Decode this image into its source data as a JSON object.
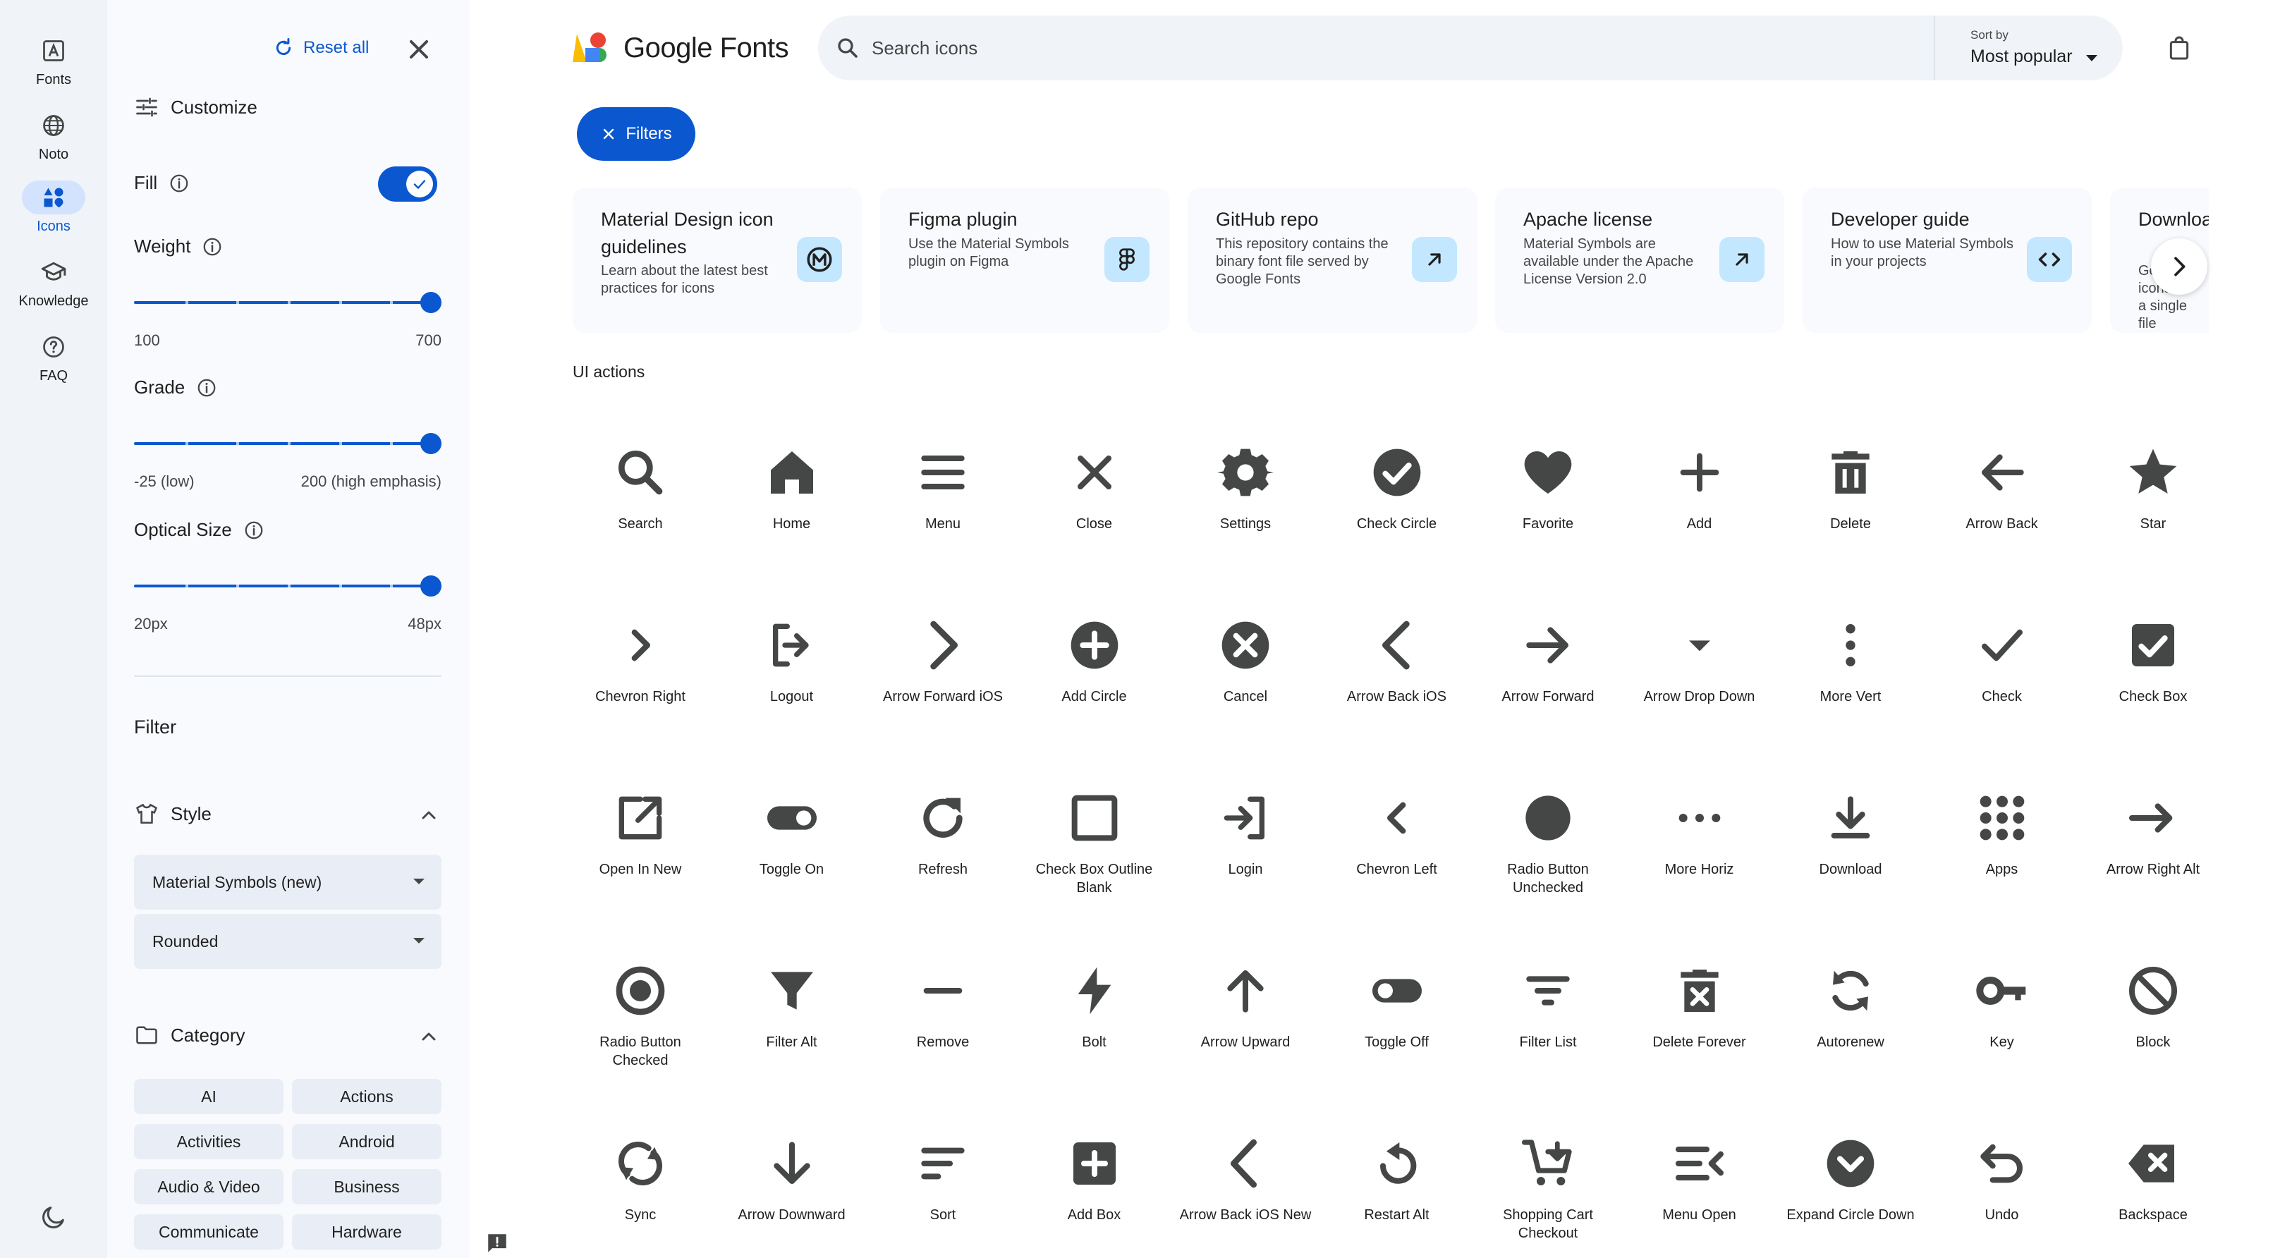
{
  "rail": {
    "items": [
      {
        "label": "Fonts",
        "icon": "fonts-icon"
      },
      {
        "label": "Noto",
        "icon": "globe-icon"
      },
      {
        "label": "Icons",
        "icon": "icons-category-icon",
        "active": true
      },
      {
        "label": "Knowledge",
        "icon": "school-icon"
      },
      {
        "label": "FAQ",
        "icon": "help-icon"
      }
    ],
    "theme_icon": "dark-mode-icon"
  },
  "panel": {
    "reset_label": "Reset all",
    "customize_label": "Customize",
    "fill_label": "Fill",
    "fill_on": true,
    "weight_label": "Weight",
    "weight_min": "100",
    "weight_max": "700",
    "weight_value": 1.0,
    "grade_label": "Grade",
    "grade_min": "-25 (low)",
    "grade_max": "200 (high emphasis)",
    "grade_value": 1.0,
    "optical_label": "Optical Size",
    "optical_min": "20px",
    "optical_max": "48px",
    "optical_value": 1.0,
    "filter_label": "Filter",
    "style_label": "Style",
    "style_select": "Material Symbols (new)",
    "variant_select": "Rounded",
    "category_label": "Category",
    "chips": [
      "AI",
      "Actions",
      "Activities",
      "Android",
      "Audio & Video",
      "Business",
      "Communicate",
      "Hardware"
    ]
  },
  "header": {
    "logo_text": "Google Fonts",
    "search_placeholder": "Search icons",
    "sort_caption": "Sort by",
    "sort_value": "Most popular",
    "filters_label": "Filters"
  },
  "cards": [
    {
      "title": "Material Design icon guidelines",
      "desc": "Learn about the latest best practices for icons",
      "icon": "material-logo-icon"
    },
    {
      "title": "Figma plugin",
      "desc": "Use the Material Symbols plugin on Figma",
      "icon": "figma-icon"
    },
    {
      "title": "GitHub repo",
      "desc": "This repository contains the binary font file served by Google Fonts",
      "icon": "arrow-outward-icon"
    },
    {
      "title": "Apache license",
      "desc": "Material Symbols are available under the Apache License Version 2.0",
      "icon": "arrow-outward-icon"
    },
    {
      "title": "Developer guide",
      "desc": "How to use Material Symbols in your projects",
      "icon": "code-icon"
    },
    {
      "title": "Download all Symbols",
      "desc": "Get all icons in a single file",
      "icon": "download-icon"
    }
  ],
  "section_title": "UI actions",
  "icons": [
    {
      "label": "Search",
      "icon": "search"
    },
    {
      "label": "Home",
      "icon": "home"
    },
    {
      "label": "Menu",
      "icon": "menu"
    },
    {
      "label": "Close",
      "icon": "close"
    },
    {
      "label": "Settings",
      "icon": "settings"
    },
    {
      "label": "Check Circle",
      "icon": "check_circle"
    },
    {
      "label": "Favorite",
      "icon": "favorite"
    },
    {
      "label": "Add",
      "icon": "add"
    },
    {
      "label": "Delete",
      "icon": "delete"
    },
    {
      "label": "Arrow Back",
      "icon": "arrow_back"
    },
    {
      "label": "Star",
      "icon": "star"
    },
    {
      "label": "Chevron Right",
      "icon": "chevron_right"
    },
    {
      "label": "Logout",
      "icon": "logout"
    },
    {
      "label": "Arrow Forward iOS",
      "icon": "arrow_forward_ios"
    },
    {
      "label": "Add Circle",
      "icon": "add_circle"
    },
    {
      "label": "Cancel",
      "icon": "cancel"
    },
    {
      "label": "Arrow Back iOS",
      "icon": "arrow_back_ios"
    },
    {
      "label": "Arrow Forward",
      "icon": "arrow_forward"
    },
    {
      "label": "Arrow Drop Down",
      "icon": "arrow_drop_down"
    },
    {
      "label": "More Vert",
      "icon": "more_vert"
    },
    {
      "label": "Check",
      "icon": "check"
    },
    {
      "label": "Check Box",
      "icon": "check_box"
    },
    {
      "label": "Open In New",
      "icon": "open_in_new"
    },
    {
      "label": "Toggle On",
      "icon": "toggle_on"
    },
    {
      "label": "Refresh",
      "icon": "refresh"
    },
    {
      "label": "Check Box Outline Blank",
      "icon": "check_box_outline_blank"
    },
    {
      "label": "Login",
      "icon": "login"
    },
    {
      "label": "Chevron Left",
      "icon": "chevron_left"
    },
    {
      "label": "Radio Button Unchecked",
      "icon": "radio_button_unchecked"
    },
    {
      "label": "More Horiz",
      "icon": "more_horiz"
    },
    {
      "label": "Download",
      "icon": "download"
    },
    {
      "label": "Apps",
      "icon": "apps"
    },
    {
      "label": "Arrow Right Alt",
      "icon": "arrow_right_alt"
    },
    {
      "label": "Radio Button Checked",
      "icon": "radio_button_checked"
    },
    {
      "label": "Filter Alt",
      "icon": "filter_alt"
    },
    {
      "label": "Remove",
      "icon": "remove"
    },
    {
      "label": "Bolt",
      "icon": "bolt"
    },
    {
      "label": "Arrow Upward",
      "icon": "arrow_upward"
    },
    {
      "label": "Toggle Off",
      "icon": "toggle_off"
    },
    {
      "label": "Filter List",
      "icon": "filter_list"
    },
    {
      "label": "Delete Forever",
      "icon": "delete_forever"
    },
    {
      "label": "Autorenew",
      "icon": "autorenew"
    },
    {
      "label": "Key",
      "icon": "key"
    },
    {
      "label": "Block",
      "icon": "block"
    },
    {
      "label": "Sync",
      "icon": "sync"
    },
    {
      "label": "Arrow Downward",
      "icon": "arrow_downward"
    },
    {
      "label": "Sort",
      "icon": "sort"
    },
    {
      "label": "Add Box",
      "icon": "add_box"
    },
    {
      "label": "Arrow Back iOS New",
      "icon": "arrow_back_ios_new"
    },
    {
      "label": "Restart Alt",
      "icon": "restart_alt"
    },
    {
      "label": "Shopping Cart Checkout",
      "icon": "shopping_cart_checkout"
    },
    {
      "label": "Menu Open",
      "icon": "menu_open"
    },
    {
      "label": "Expand Circle Down",
      "icon": "expand_circle_down"
    },
    {
      "label": "Undo",
      "icon": "undo"
    },
    {
      "label": "Backspace",
      "icon": "backspace"
    }
  ],
  "colors": {
    "accent": "#0b57d0",
    "icon": "#444746",
    "rail_bg": "#f0f4f9",
    "panel_bg": "#f8fafd"
  }
}
